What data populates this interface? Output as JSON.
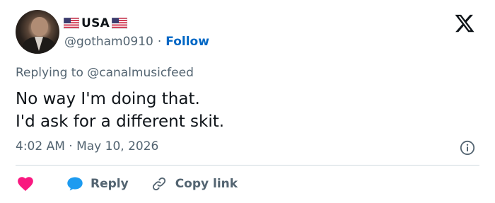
{
  "tweet": {
    "author": {
      "display_name": "USA",
      "handle": "@gotham0910",
      "separator": "·",
      "follow_label": "Follow",
      "flag_icon": "us-flag-icon"
    },
    "replying_to": "Replying to @canalmusicfeed",
    "text_lines": [
      "No way I'm doing that.",
      "I'd ask for a different skit."
    ],
    "timestamp": "4:02 AM · May 10, 2026"
  },
  "actions": {
    "like_icon": "heart-icon",
    "reply_label": "Reply",
    "copy_label": "Copy link"
  },
  "colors": {
    "follow": "#0067c5",
    "like": "#f91880",
    "reply_bubble": "#1d9bf0",
    "muted": "#536471"
  }
}
